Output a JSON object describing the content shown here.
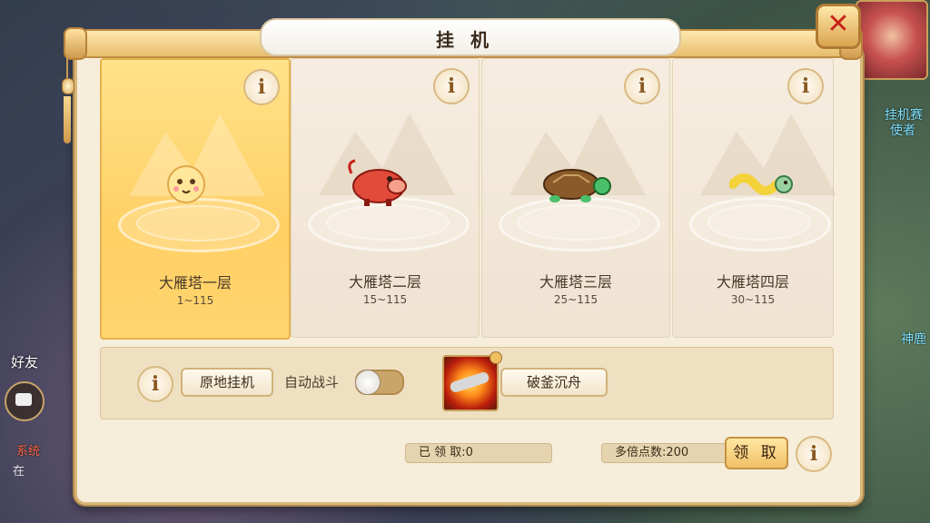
{
  "dialog": {
    "title": "挂机"
  },
  "cards": [
    {
      "name": "大雁塔一层",
      "range": "1~115",
      "selected": true,
      "creature": "egg-creature"
    },
    {
      "name": "大雁塔二层",
      "range": "15~115",
      "selected": false,
      "creature": "boar-creature"
    },
    {
      "name": "大雁塔三层",
      "range": "25~115",
      "selected": false,
      "creature": "turtle-creature"
    },
    {
      "name": "大雁塔四层",
      "range": "30~115",
      "selected": false,
      "creature": "dragon-creature"
    }
  ],
  "controls": {
    "idle_here_label": "原地挂机",
    "auto_battle_label": "自动战斗",
    "auto_battle_on": false,
    "skill_label": "破釜沉舟"
  },
  "footer": {
    "claimed_text": "已 领 取:0",
    "multiplier_text": "多倍点数:200",
    "claim_label": "领 取"
  },
  "background": {
    "friends_label": "好友",
    "system_label": "系统",
    "system_text": "在",
    "right_text_1": "挂机赛",
    "right_text_2": "使者",
    "right_text_3": "神鹿"
  },
  "colors": {
    "accent": "#ffd065",
    "frame": "#d9b77a",
    "close": "#c8221a"
  }
}
